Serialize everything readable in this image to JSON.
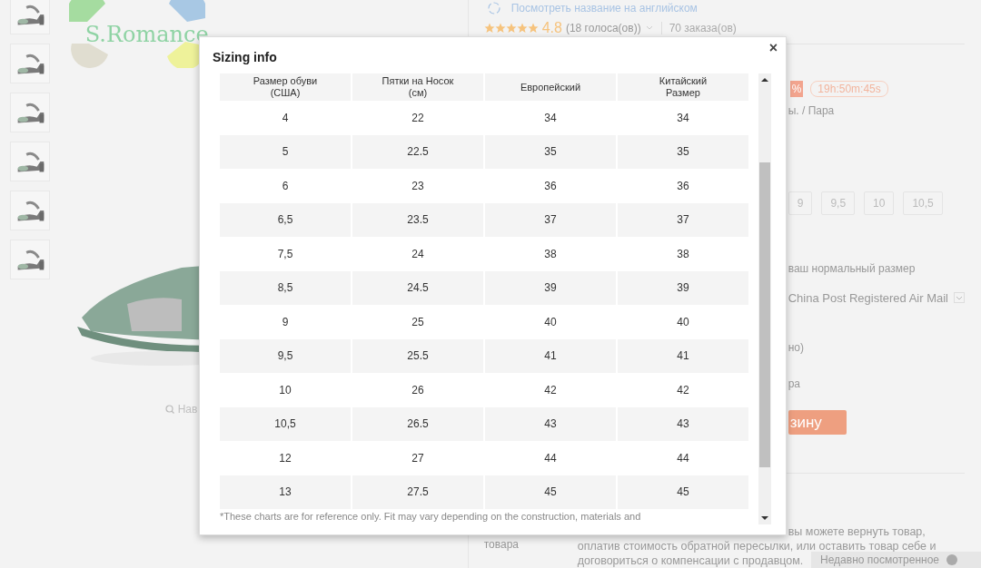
{
  "page": {
    "logo": "S.Romance",
    "thumbnails": [
      {
        "kind": "picture"
      },
      {
        "kind": "picture"
      },
      {
        "kind": "picture"
      },
      {
        "kind": "picture"
      },
      {
        "kind": "picture"
      },
      {
        "kind": "picture"
      }
    ],
    "zoom_hint": "Нав",
    "translate_link": "Посмотреть название на английском",
    "rating": {
      "stars": 5,
      "score": "4.8",
      "votes": "(18 голоса(ов))",
      "orders": "70 заказа(ов)"
    },
    "discount": "%",
    "timer": "19h:50m:45s",
    "unit": "ы. / Пара",
    "sizes": [
      {
        "label": "9",
        "selected": false
      },
      {
        "label": "9,5",
        "selected": false
      },
      {
        "label": "10",
        "selected": false
      },
      {
        "label": "10,5",
        "selected": false
      }
    ],
    "size_hint": "ваш нормальный размер",
    "shipping": "China Post Registered Air Mail",
    "line_1": "но)",
    "line_2": "ра",
    "cart_button": "зину",
    "return_label": [
      "товара"
    ],
    "return_text": [
      "вы можете вернуть товар,",
      "оплатив стоимость обратной пересылки, или оставить товар себе и",
      "договориться о компенсации с продавцом."
    ],
    "recently_viewed": "Недавно посмотренное"
  },
  "dialog": {
    "title": "Sizing info",
    "close": "×",
    "columns": [
      "Размер обуви (США)",
      "Пятки на Носок (см)",
      "Европейский",
      "Китайский Размер"
    ],
    "rows": [
      [
        "4",
        "22",
        "34",
        "34"
      ],
      [
        "5",
        "22.5",
        "35",
        "35"
      ],
      [
        "6",
        "23",
        "36",
        "36"
      ],
      [
        "6,5",
        "23.5",
        "37",
        "37"
      ],
      [
        "7,5",
        "24",
        "38",
        "38"
      ],
      [
        "8,5",
        "24.5",
        "39",
        "39"
      ],
      [
        "9",
        "25",
        "40",
        "40"
      ],
      [
        "9,5",
        "25.5",
        "41",
        "41"
      ],
      [
        "10",
        "26",
        "42",
        "42"
      ],
      [
        "10,5",
        "26.5",
        "43",
        "43"
      ],
      [
        "12",
        "27",
        "44",
        "44"
      ],
      [
        "13",
        "27.5",
        "45",
        "45"
      ]
    ],
    "note": "*These charts are for reference only. Fit may vary depending on the construction, materials and"
  }
}
